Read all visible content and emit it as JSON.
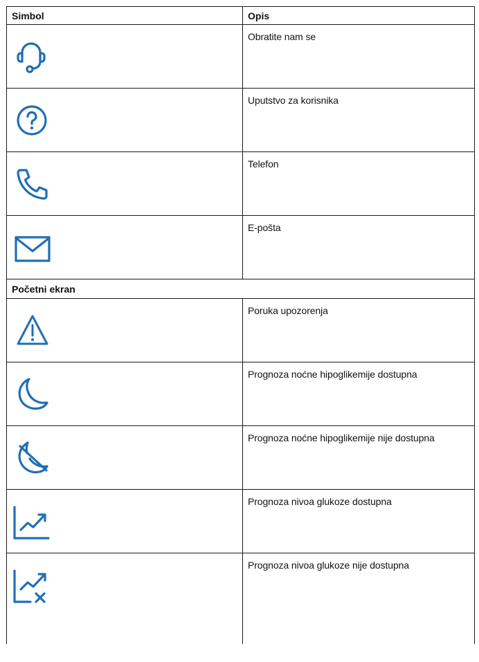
{
  "header": {
    "col_symbol": "Simbol",
    "col_description": "Opis"
  },
  "rows_top": [
    {
      "icon": "headset-icon",
      "description": "Obratite nam se"
    },
    {
      "icon": "question-icon",
      "description": "Uputstvo za korisnika"
    },
    {
      "icon": "phone-icon",
      "description": "Telefon"
    },
    {
      "icon": "mail-icon",
      "description": "E-pošta"
    }
  ],
  "section": {
    "title": "Početni ekran"
  },
  "rows_bottom": [
    {
      "icon": "warning-icon",
      "description": "Poruka upozorenja"
    },
    {
      "icon": "moon-icon",
      "description": "Prognoza noćne hipoglikemije dostupna"
    },
    {
      "icon": "moon-slash-icon",
      "description": "Prognoza noćne hipoglikemije nije dostupna"
    },
    {
      "icon": "trend-chart-icon",
      "description": "Prognoza nivoa glukoze dostupna"
    },
    {
      "icon": "trend-chart-x-icon",
      "description": "Prognoza nivoa glukoze nije dostupna"
    }
  ],
  "colors": {
    "icon": "#1f6fb4",
    "border": "#1a1a1a",
    "text": "#111111"
  }
}
